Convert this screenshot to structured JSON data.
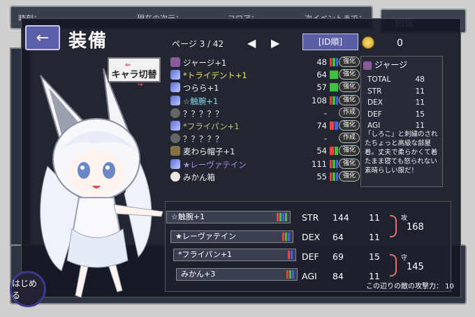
{
  "background": {
    "top_labels": [
      "時刻：",
      "現在の次元：",
      "フロア：",
      "次イベントまで："
    ],
    "right_button": "回復",
    "start_button": "はじめる"
  },
  "header": {
    "back_arrow": "←",
    "title": "装備",
    "char_switch": "キャラ切替"
  },
  "list": {
    "page": "ページ 3 / 42",
    "prev": "◀",
    "next": "▶",
    "sort": "[ID順]",
    "coins": "0",
    "items": [
      {
        "icon": "cloth",
        "name": "ジャージ+1",
        "color": "white",
        "value": "48",
        "bars": [
          "#ff4040",
          "#40c040",
          "#4060ff"
        ],
        "action": "強化"
      },
      {
        "icon": "sword",
        "name": "*トライデント+1",
        "color": "yellow",
        "value": "64",
        "bars": [
          "#40c040"
        ],
        "action": "強化"
      },
      {
        "icon": "sword",
        "name": "つらら+1",
        "color": "white",
        "value": "57",
        "bars": [
          "#40c040"
        ],
        "action": "強化"
      },
      {
        "icon": "sword",
        "name": "☆触腕+1",
        "color": "cyan",
        "value": "108",
        "bars": [
          "#ff4040",
          "#40c040",
          "#4060ff"
        ],
        "action": "強化"
      },
      {
        "icon": "empty",
        "name": "？？？？？",
        "color": "white",
        "value": "-",
        "bars": [],
        "action": "作成"
      },
      {
        "icon": "sword",
        "name": "*フライパン+1",
        "color": "khaki",
        "value": "74",
        "bars": [
          "#ff4040",
          "#4060ff"
        ],
        "action": "強化"
      },
      {
        "icon": "empty",
        "name": "？？？？？",
        "color": "white",
        "value": "-",
        "bars": [],
        "action": "作成"
      },
      {
        "icon": "hat",
        "name": "麦わら帽子+1",
        "color": "white",
        "value": "54",
        "bars": [
          "#ff4040",
          "#40c040"
        ],
        "action": "強化"
      },
      {
        "icon": "sword",
        "name": "★レーヴァテイン",
        "color": "purple",
        "value": "111",
        "bars": [
          "#ff4040",
          "#40c040",
          "#4060ff"
        ],
        "action": "強化"
      },
      {
        "icon": "box",
        "name": "みかん箱",
        "color": "white",
        "value": "55",
        "bars": [
          "#ff4040",
          "#40c040",
          "#4060ff"
        ],
        "action": "強化"
      }
    ]
  },
  "detail": {
    "name": "ジャージ",
    "stats": [
      {
        "label": "TOTAL",
        "value": "48"
      },
      {
        "label": "STR",
        "value": "11"
      },
      {
        "label": "DEX",
        "value": "11"
      },
      {
        "label": "DEF",
        "value": "15"
      },
      {
        "label": "AGI",
        "value": "11"
      }
    ],
    "description": "「しろこ」と刺繍のされたちょっと高級な部屋着。丈夫で柔らかくて着たまま寝ても怒られない素晴らしい服だ！"
  },
  "equipped": {
    "slots": [
      {
        "name": "☆触腕+1",
        "bars": [
          "#ff4040",
          "#40c040",
          "#4060ff",
          "#40c040"
        ]
      },
      {
        "name": "★レーヴァテイン",
        "bars": [
          "#ff4040",
          "#40c040",
          "#4060ff"
        ]
      },
      {
        "name": "*フライパン+1",
        "bars": [
          "#ff4040",
          "#4060ff"
        ]
      },
      {
        "name": "みかん+3",
        "bars": [
          "#ff4040",
          "#40c040",
          "#4060ff"
        ]
      }
    ],
    "stats": [
      {
        "label": "STR",
        "a": "144",
        "b": "11"
      },
      {
        "label": "DEX",
        "a": "64",
        "b": "11"
      },
      {
        "label": "DEF",
        "a": "69",
        "b": "15"
      },
      {
        "label": "AGI",
        "a": "84",
        "b": "11"
      }
    ],
    "attack_label": "攻",
    "attack_value": "168",
    "defense_label": "守",
    "defense_value": "145",
    "enemy_attack": "この辺りの敵の攻撃力： 10"
  }
}
